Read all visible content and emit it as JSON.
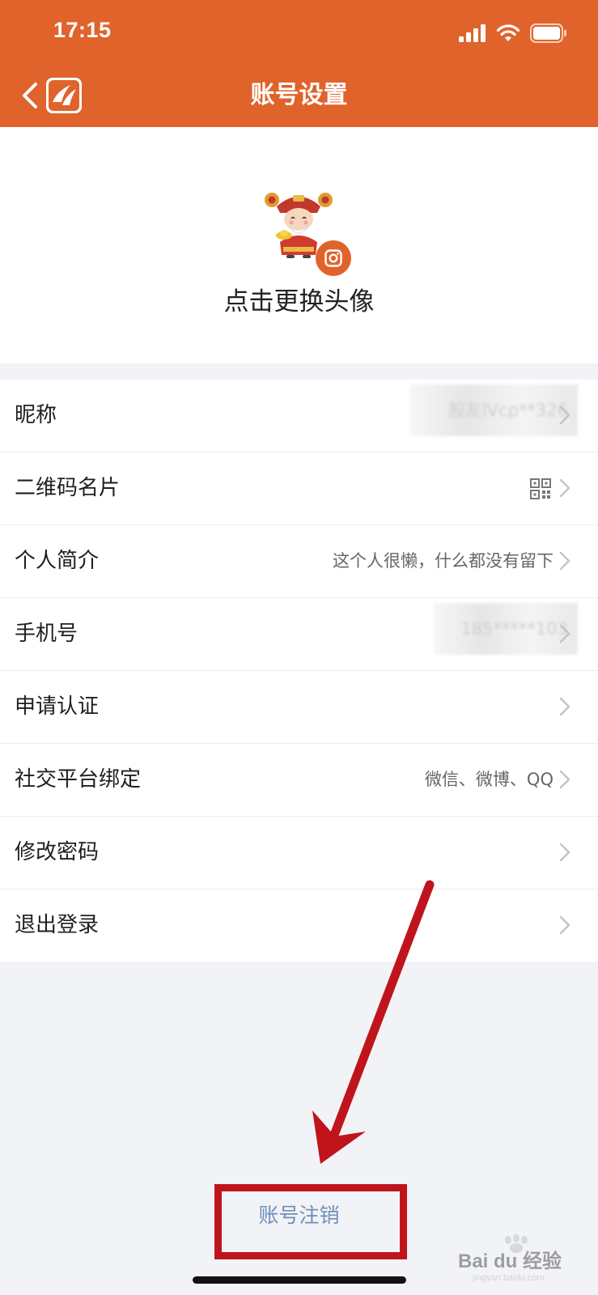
{
  "status_bar": {
    "time": "17:15"
  },
  "header": {
    "title": "账号设置",
    "background_color": "#e0632b"
  },
  "avatar_section": {
    "label": "点击更换头像"
  },
  "settings": [
    {
      "label": "昵称",
      "value": "股友lVcp**326"
    },
    {
      "label": "二维码名片",
      "value": ""
    },
    {
      "label": "个人简介",
      "value": "这个人很懒，什么都没有留下"
    },
    {
      "label": "手机号",
      "value": "185*****103"
    },
    {
      "label": "申请认证",
      "value": ""
    },
    {
      "label": "社交平台绑定",
      "value": "微信、微博、QQ"
    },
    {
      "label": "修改密码",
      "value": ""
    },
    {
      "label": "退出登录",
      "value": ""
    }
  ],
  "footer": {
    "deactivate_label": "账号注销",
    "deactivate_color": "#6d8fb9"
  },
  "annotation": {
    "highlight_color": "#c0141c"
  },
  "watermark": {
    "text": "Bai du 经验",
    "url_text": "jingyan.baidu.com"
  }
}
